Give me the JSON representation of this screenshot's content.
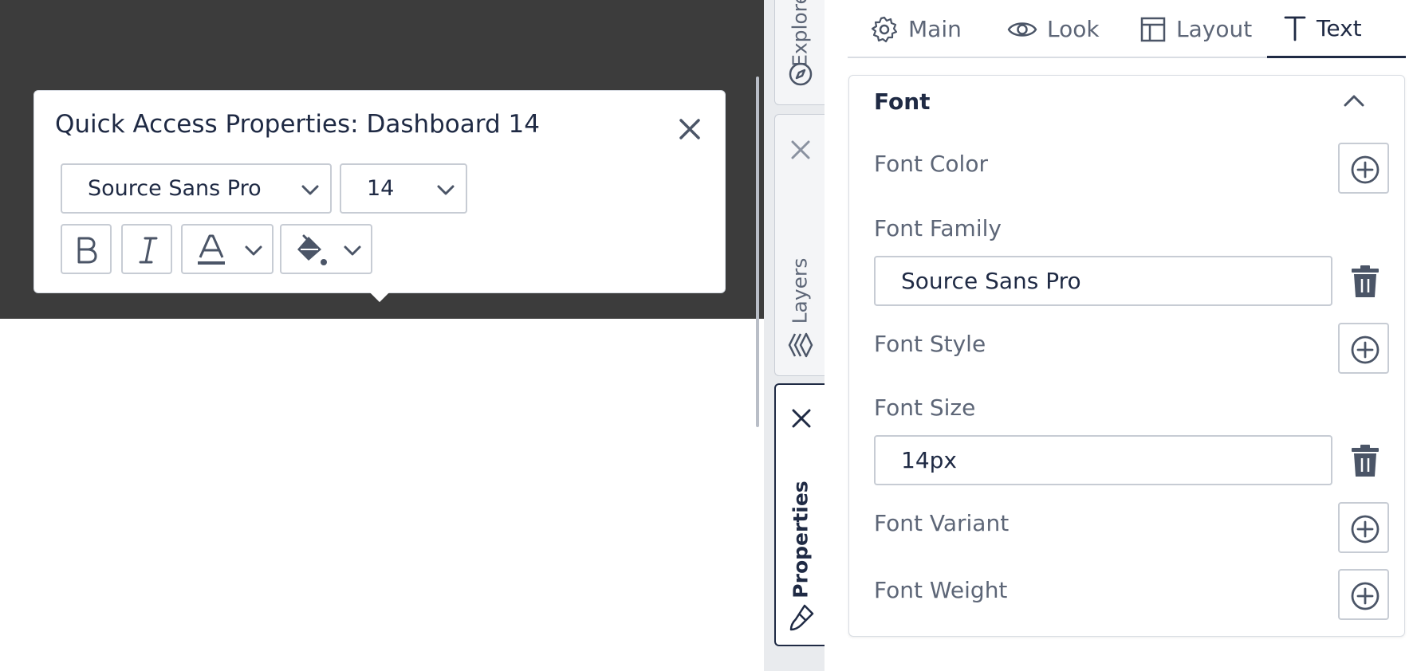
{
  "popup": {
    "title": "Quick Access Properties: Dashboard 14",
    "font_family": "Source Sans Pro",
    "font_size": "14",
    "bold_label": "B",
    "italic_label": "I",
    "text_color_label": "A",
    "icons": {
      "close": "close-icon",
      "dropdown": "chevron-down-icon",
      "fill": "paint-bucket-icon"
    }
  },
  "dock": {
    "explore_label": "Explore",
    "layers_label": "Layers",
    "properties_label": "Properties",
    "icons": {
      "explore": "compass-icon",
      "layers": "layers-icon",
      "properties": "brush-icon",
      "close": "close-icon"
    }
  },
  "tabs": [
    {
      "label": "Main",
      "icon": "gear-icon"
    },
    {
      "label": "Look",
      "icon": "eye-icon"
    },
    {
      "label": "Layout",
      "icon": "layout-icon"
    },
    {
      "label": "Text",
      "icon": "text-icon",
      "active": true
    }
  ],
  "section": {
    "title": "Font",
    "properties": {
      "font_color": "Font Color",
      "font_family": "Font Family",
      "font_family_value": "Source Sans Pro",
      "font_style": "Font Style",
      "font_size": "Font Size",
      "font_size_value": "14px",
      "font_variant": "Font Variant",
      "font_weight": "Font Weight"
    }
  },
  "colors": {
    "canvas_dark": "#3c3c3c",
    "text_primary": "#1f2a44",
    "text_secondary": "#5d6677",
    "border": "#c7ccd4",
    "icon": "#4b5567"
  }
}
